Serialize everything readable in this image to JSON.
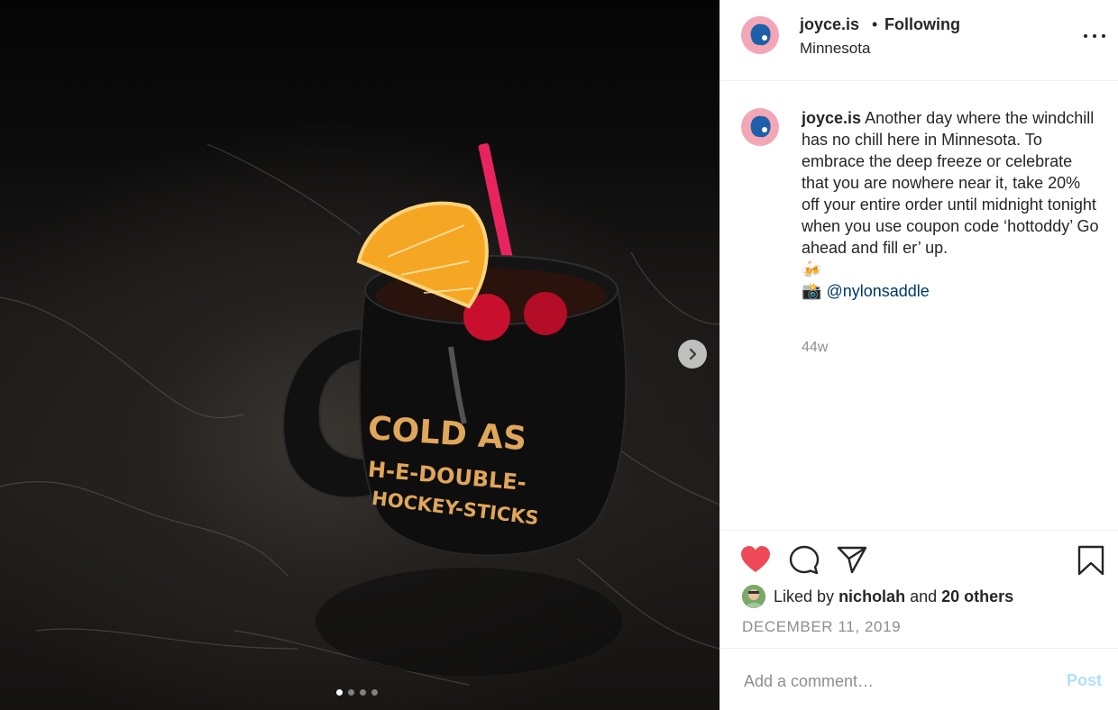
{
  "post": {
    "image_alt": "",
    "mug_text": [
      "COLD AS",
      "H-E-DOUBLE-",
      "HOCKEY-STICKS"
    ],
    "carousel": {
      "count": 4,
      "active_index": 0
    }
  },
  "header": {
    "username": "joyce.is",
    "separator": "•",
    "follow_state": "Following",
    "location": "Minnesota"
  },
  "caption": {
    "username": "joyce.is",
    "text": "Another day where the windchill has no chill here in Minnesota. To embrace the deep freeze or celebrate that you are nowhere near it, take 20% off your entire order until midnight tonight when you use coupon code ‘hottoddy’ Go ahead and fill er’ up.",
    "emoji_line": "🍻",
    "credit_emoji": "📸",
    "mention": "@nylonsaddle",
    "time": "44w"
  },
  "likes": {
    "prefix": "Liked by",
    "user": "nicholah",
    "joiner": "and",
    "others": "20 others"
  },
  "date": "DECEMBER 11, 2019",
  "comment": {
    "placeholder": "Add a comment…",
    "post_label": "Post"
  },
  "colors": {
    "heart": "#ed4956",
    "link": "#00376b",
    "post_disabled": "#b2dffc",
    "avatar_bg": "#f3a6b5",
    "mug_text": "#e0a65a"
  },
  "icons": [
    "more-options-icon",
    "next-arrow-icon",
    "heart-icon",
    "comment-icon",
    "share-icon",
    "bookmark-icon"
  ]
}
